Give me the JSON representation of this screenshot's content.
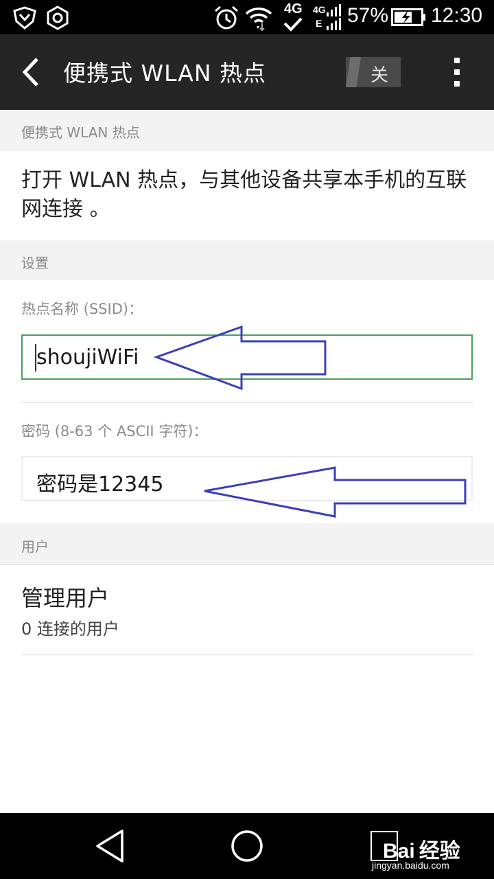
{
  "status_bar": {
    "battery_percent": "57%",
    "time": "12:30",
    "network_4g": "4G",
    "network_4g_small": "4G",
    "network_e": "E",
    "icons": [
      "shield-icon",
      "hexagon-nut-icon",
      "alarm-clock-icon",
      "wifi-icon",
      "signal-icon",
      "battery-charging-icon"
    ]
  },
  "app_bar": {
    "title": "便携式 WLAN 热点",
    "toggle_label": "关"
  },
  "sections": {
    "hotspot": "便携式 WLAN 热点",
    "settings": "设置",
    "users": "用户"
  },
  "description": "打开 WLAN 热点，与其他设备共享本手机的互联网连接 。",
  "ssid": {
    "label": "热点名称 (SSID)：",
    "value": "shoujiWiFi"
  },
  "password": {
    "label": "密码 (8-63 个 ASCII 字符)：",
    "value": "密码是12345"
  },
  "manage_users": {
    "title": "管理用户",
    "subtitle": "0 连接的用户"
  },
  "watermark": {
    "text": "Bai 经验",
    "url": "jingyan.baidu.com"
  },
  "colors": {
    "focus_border": "#49a05e",
    "annotation_arrow": "#3a3fb8",
    "app_bar": "#252525"
  }
}
